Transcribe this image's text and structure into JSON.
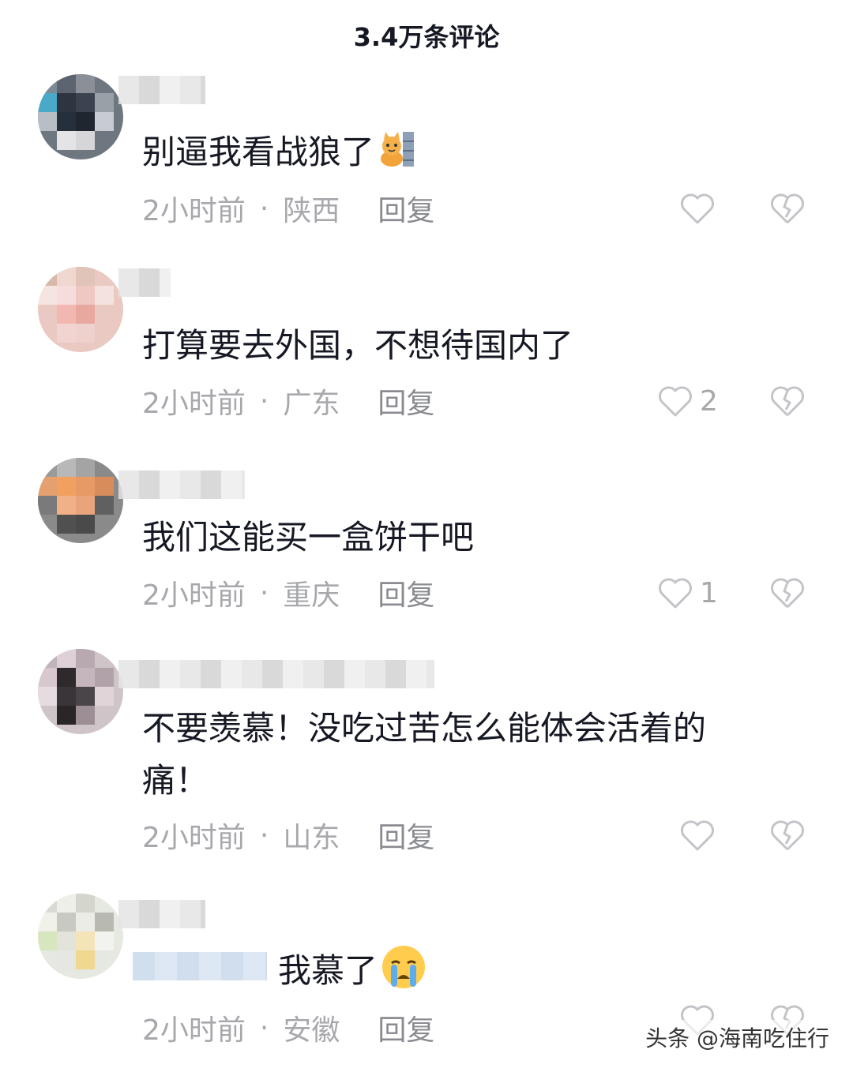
{
  "header": {
    "title": "3.4万条评论"
  },
  "comments": [
    {
      "text": "别逼我看战狼了",
      "time": "2小时前",
      "location": "陕西",
      "reply": "回复",
      "likes": "",
      "emoji": "cat-wall-emoji"
    },
    {
      "text": "打算要去外国，不想待国内了",
      "time": "2小时前",
      "location": "广东",
      "reply": "回复",
      "likes": "2"
    },
    {
      "text": "我们这能买一盒饼干吧",
      "time": "2小时前",
      "location": "重庆",
      "reply": "回复",
      "likes": "1"
    },
    {
      "text": "不要羡慕！没吃过苦怎么能体会活着的痛！",
      "time": "2小时前",
      "location": "山东",
      "reply": "回复",
      "likes": ""
    },
    {
      "text": "我慕了",
      "time": "2小时前",
      "location": "安徽",
      "reply": "回复",
      "likes": "",
      "emoji": "crying-face-emoji"
    }
  ],
  "separator": "·",
  "watermark": "头条 @海南吃住行",
  "colors": {
    "text": "#161823",
    "meta": "#a7a8ac",
    "icon": "#c3c4c8"
  }
}
